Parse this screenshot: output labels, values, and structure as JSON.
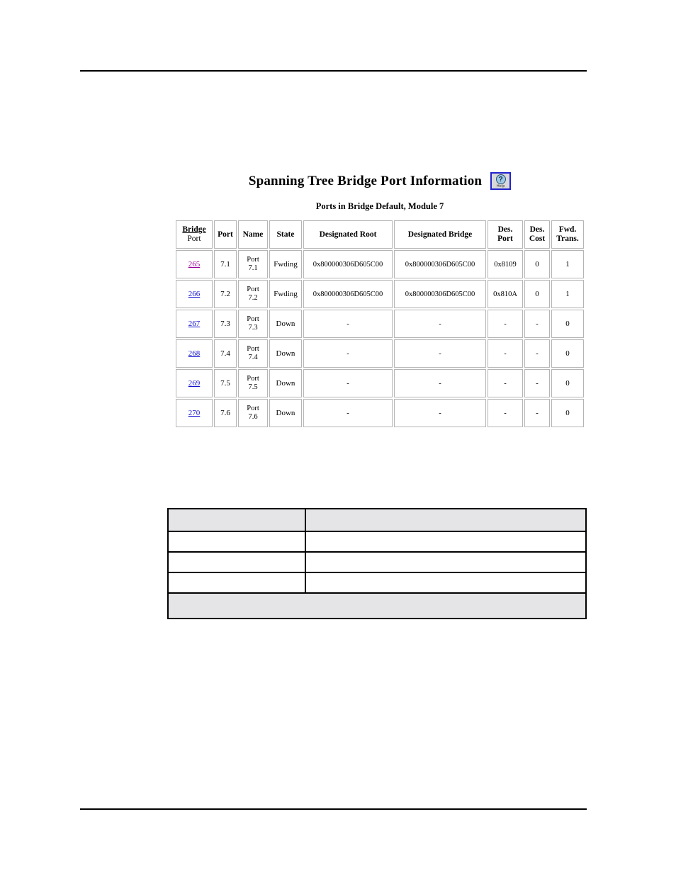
{
  "page": {
    "rules": {
      "top_label": "",
      "bottom_label": ""
    }
  },
  "panel": {
    "title": "Spanning Tree Bridge Port Information",
    "subtitle": "Ports in Bridge Default, Module 7",
    "help_button": {
      "icon": "question-mark-help-icon",
      "glyph": "?",
      "label": "Help",
      "border_color": "#2222CC",
      "circle_color": "#9ECAE8"
    }
  },
  "table": {
    "headers": [
      {
        "line1": "Bridge",
        "line2": "Port",
        "sortable": true
      },
      {
        "line1": "Port",
        "line2": "",
        "sortable": false
      },
      {
        "line1": "Name",
        "line2": "",
        "sortable": false
      },
      {
        "line1": "State",
        "line2": "",
        "sortable": false
      },
      {
        "line1": "Designated Root",
        "line2": "",
        "sortable": false
      },
      {
        "line1": "Designated Bridge",
        "line2": "",
        "sortable": false
      },
      {
        "line1": "Des.",
        "line2": "Port",
        "sortable": false
      },
      {
        "line1": "Des.",
        "line2": "Cost",
        "sortable": false
      },
      {
        "line1": "Fwd.",
        "line2": "Trans.",
        "sortable": false
      }
    ],
    "link_colors": {
      "visited": "#990099",
      "unvisited": "#1111CC"
    },
    "rows": [
      {
        "bridge_port": "265",
        "link_state": "visited",
        "port": "7.1",
        "name_l1": "Port",
        "name_l2": "7.1",
        "state": "Fwding",
        "designated_root": "0x800000306D605C00",
        "designated_bridge": "0x800000306D605C00",
        "des_port": "0x8109",
        "des_cost": "0",
        "fwd_trans": "1"
      },
      {
        "bridge_port": "266",
        "link_state": "unvisited",
        "port": "7.2",
        "name_l1": "Port",
        "name_l2": "7.2",
        "state": "Fwding",
        "designated_root": "0x800000306D605C00",
        "designated_bridge": "0x800000306D605C00",
        "des_port": "0x810A",
        "des_cost": "0",
        "fwd_trans": "1"
      },
      {
        "bridge_port": "267",
        "link_state": "unvisited",
        "port": "7.3",
        "name_l1": "Port",
        "name_l2": "7.3",
        "state": "Down",
        "designated_root": "-",
        "designated_bridge": "-",
        "des_port": "-",
        "des_cost": "-",
        "fwd_trans": "0"
      },
      {
        "bridge_port": "268",
        "link_state": "unvisited",
        "port": "7.4",
        "name_l1": "Port",
        "name_l2": "7.4",
        "state": "Down",
        "designated_root": "-",
        "designated_bridge": "-",
        "des_port": "-",
        "des_cost": "-",
        "fwd_trans": "0"
      },
      {
        "bridge_port": "269",
        "link_state": "unvisited",
        "port": "7.5",
        "name_l1": "Port",
        "name_l2": "7.5",
        "state": "Down",
        "designated_root": "-",
        "designated_bridge": "-",
        "des_port": "-",
        "des_cost": "-",
        "fwd_trans": "0"
      },
      {
        "bridge_port": "270",
        "link_state": "unvisited",
        "port": "7.6",
        "name_l1": "Port",
        "name_l2": "7.6",
        "state": "Down",
        "designated_root": "-",
        "designated_bridge": "-",
        "des_port": "-",
        "des_cost": "-",
        "fwd_trans": "0"
      }
    ]
  },
  "blank_table": {
    "header_cells": [
      "",
      ""
    ],
    "body_rows": [
      [
        "",
        ""
      ],
      [
        "",
        ""
      ],
      [
        "",
        ""
      ]
    ],
    "footer_cell": ""
  }
}
